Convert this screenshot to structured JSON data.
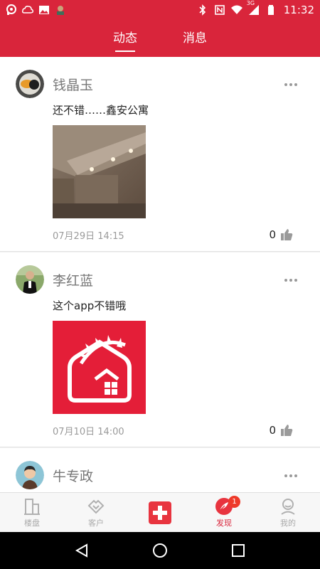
{
  "status_bar": {
    "time": "11:32",
    "network": "3G"
  },
  "top_tabs": [
    {
      "label": "动态",
      "active": true
    },
    {
      "label": "消息",
      "active": false
    }
  ],
  "posts": [
    {
      "author": "钱晶玉",
      "text": "还不错……鑫安公寓",
      "time": "07月29日 14:15",
      "likes": "0",
      "image": "room-photo"
    },
    {
      "author": "李红蓝",
      "text": "这个app不错哦",
      "time": "07月10日 14:00",
      "likes": "0",
      "image": "app-logo"
    },
    {
      "author": "牛专政",
      "text": "",
      "time": "",
      "likes": "",
      "image": ""
    }
  ],
  "bottom_nav": [
    {
      "label": "楼盘",
      "icon": "building-icon",
      "active": false
    },
    {
      "label": "客户",
      "icon": "handshake-icon",
      "active": false
    },
    {
      "label": "",
      "icon": "plus-icon",
      "active": false
    },
    {
      "label": "发现",
      "icon": "feather-icon",
      "active": true,
      "badge": "1"
    },
    {
      "label": "我的",
      "icon": "person-icon",
      "active": false
    }
  ],
  "colors": {
    "accent": "#d9253b",
    "badge": "#ee3a2a"
  }
}
